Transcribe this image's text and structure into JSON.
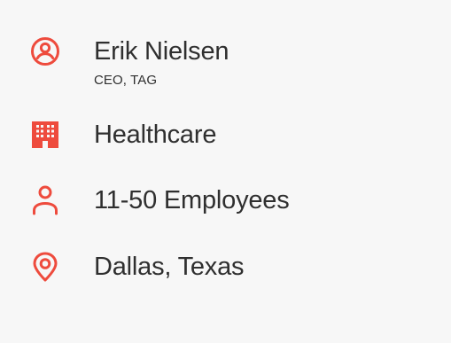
{
  "accent_color": "#ee4b3d",
  "contact": {
    "name": "Erik Nielsen",
    "title": "CEO, TAG",
    "name_icon": "user-circle-icon"
  },
  "industry": {
    "label": "Healthcare",
    "icon": "building-icon"
  },
  "company_size": {
    "label": "11-50 Employees",
    "icon": "person-icon"
  },
  "location": {
    "label": "Dallas, Texas",
    "icon": "map-pin-icon"
  }
}
